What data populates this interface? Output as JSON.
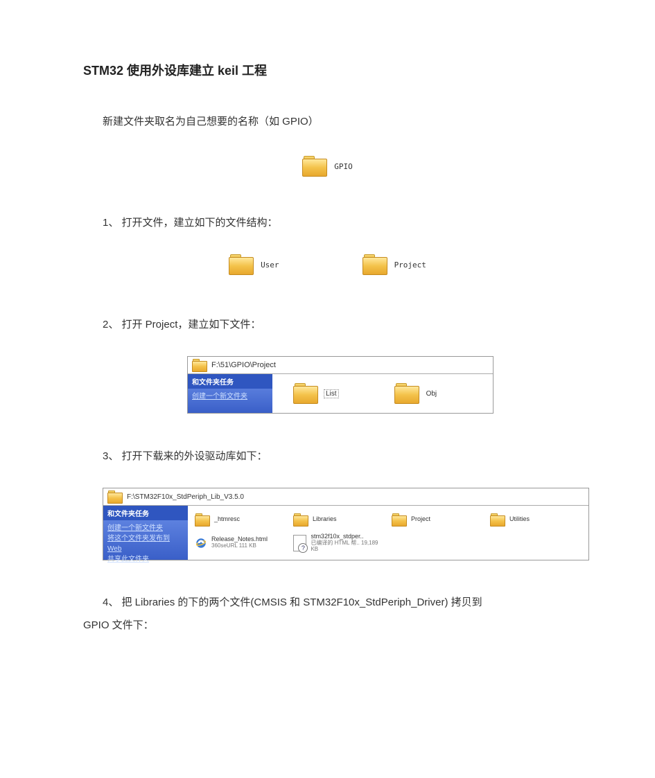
{
  "title": "STM32 使用外设库建立 keil 工程",
  "intro_para": "新建文件夹取名为自己想要的名称（如 GPIO）",
  "folder_gpio": "GPIO",
  "step1": "1、  打开文件，建立如下的文件结构：",
  "folder_user": "User",
  "folder_project": "Project",
  "step2": "2、  打开 Project，建立如下文件：",
  "explorer2": {
    "address": "F:\\51\\GPIO\\Project",
    "side_title": "和文件夹任务",
    "side_link": "创建一个新文件夹",
    "item1": "List",
    "item2": "Obj"
  },
  "step3": "3、  打开下载来的外设驱动库如下：",
  "explorer3": {
    "address": "F:\\STM32F10x_StdPeriph_Lib_V3.5.0",
    "side_title": "和文件夹任务",
    "side_link1": "创建一个新文件夹",
    "side_link2": "将这个文件夹发布到 Web",
    "side_link3": "共享此文件夹",
    "items": [
      {
        "name": "_htmresc",
        "type": "folder"
      },
      {
        "name": "Libraries",
        "type": "folder"
      },
      {
        "name": "Project",
        "type": "folder"
      },
      {
        "name": "Utilities",
        "type": "folder"
      },
      {
        "name": "Release_Notes.html",
        "sub": "360seURL\n111 KB",
        "type": "ie"
      },
      {
        "name": "stm32f10x_stdper..",
        "sub": "已编译的 HTML 帮..\n19,189 KB",
        "type": "html"
      }
    ]
  },
  "step4_line1": "4、  把 Libraries 的下的两个文件(CMSIS 和 STM32F10x_StdPeriph_Driver) 拷贝到",
  "step4_line2": "GPIO 文件下："
}
